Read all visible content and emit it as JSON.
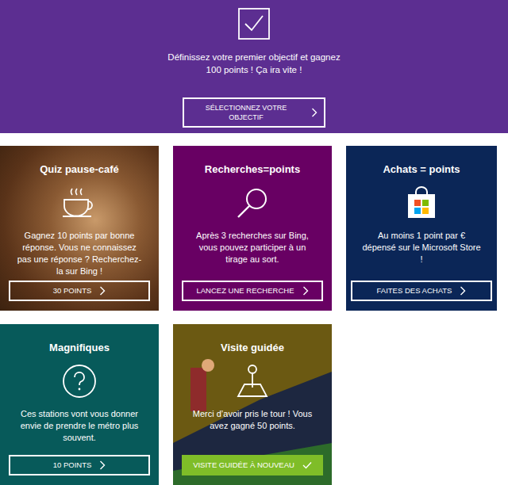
{
  "banner": {
    "text": "Définissez votre premier objectif et gagnez 100 points ! Ça ira vite !",
    "button": "SÉLECTIONNEZ VOTRE OBJECTIF"
  },
  "cards": [
    {
      "title": "Quiz pause-café",
      "description": "Gagnez 10 points par bonne réponse. Vous ne connaissez pas une réponse ? Recherchez-la sur Bing !",
      "button": "30 POINTS",
      "completed": false,
      "color": "#6b4327"
    },
    {
      "title": "Recherches=points",
      "description": "Après 3 recherches sur Bing, vous pouvez participer à un tirage au sort.",
      "button": "LANCEZ UNE RECHERCHE",
      "completed": false,
      "color": "#680063"
    },
    {
      "title": "Achats = points",
      "description": "Au moins 1 point par € dépensé sur le Microsoft Store !",
      "button": "FAITES DES ACHATS",
      "completed": false,
      "color": "#0b2657"
    },
    {
      "title": "Magnifiques",
      "description": "Ces stations vont vous donner envie de prendre le métro plus souvent.",
      "button": "10 POINTS",
      "completed": false,
      "color": "#075a5a"
    },
    {
      "title": "Visite guidée",
      "description": "Merci d’avoir pris le tour ! Vous avez gagné 50 points.",
      "button": "VISITE GUIDÉE À NOUVEAU",
      "completed": true,
      "color": "#6b5912"
    }
  ]
}
